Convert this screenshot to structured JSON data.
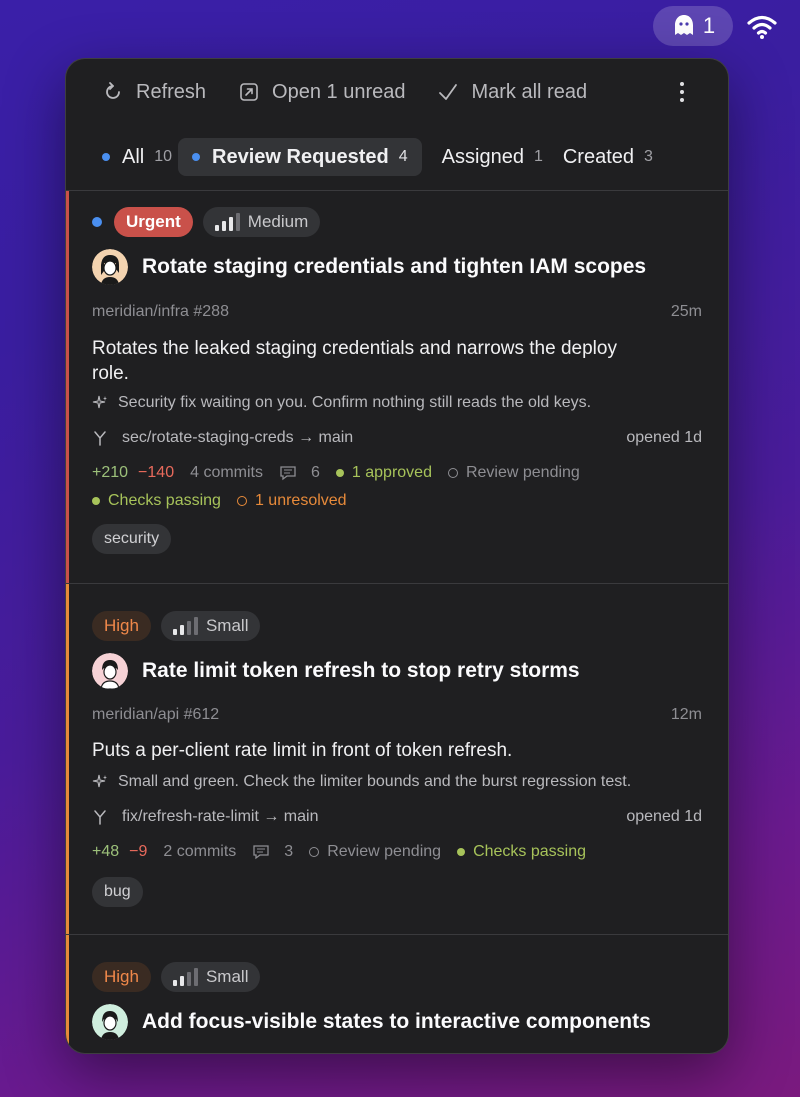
{
  "menubar": {
    "ghost_count": "1"
  },
  "toolbar": {
    "refresh": "Refresh",
    "open_unread": "Open 1 unread",
    "mark_all_read": "Mark all read"
  },
  "tabs": [
    {
      "label": "All",
      "count": "10",
      "dot": true
    },
    {
      "label": "Review Requested",
      "count": "4",
      "dot": true,
      "active": true
    },
    {
      "label": "Assigned",
      "count": "1"
    },
    {
      "label": "Created",
      "count": "3"
    }
  ],
  "cards": [
    {
      "priority": "Urgent",
      "size": "Medium",
      "title": "Rotate staging credentials and tighten IAM scopes",
      "repo": "meridian/infra #288",
      "age": "25m",
      "description": "Rotates the leaked staging credentials and narrows the deploy role.",
      "ai_summary": "Security fix waiting on you. Confirm nothing still reads the old keys.",
      "branch": "sec/rotate-staging-creds → main",
      "opened": "opened 1d",
      "additions": "+210",
      "deletions": "−140",
      "commits": "4 commits",
      "comments": "6",
      "approved": "1 approved",
      "review": "Review pending",
      "checks": "Checks passing",
      "unresolved": "1 unresolved",
      "label": "security",
      "accent": "#c9514a"
    },
    {
      "priority": "High",
      "size": "Small",
      "title": "Rate limit token refresh to stop retry storms",
      "repo": "meridian/api #612",
      "age": "12m",
      "description": "Puts a per-client rate limit in front of token refresh.",
      "ai_summary": "Small and green. Check the limiter bounds and the burst regression test.",
      "branch": "fix/refresh-rate-limit → main",
      "opened": "opened 1d",
      "additions": "+48",
      "deletions": "−9",
      "commits": "2 commits",
      "comments": "3",
      "review": "Review pending",
      "checks": "Checks passing",
      "label": "bug",
      "accent": "#e78a3a"
    },
    {
      "priority": "High",
      "size": "Small",
      "title": "Add focus-visible states to interactive components",
      "accent": "#e78a3a"
    }
  ]
}
